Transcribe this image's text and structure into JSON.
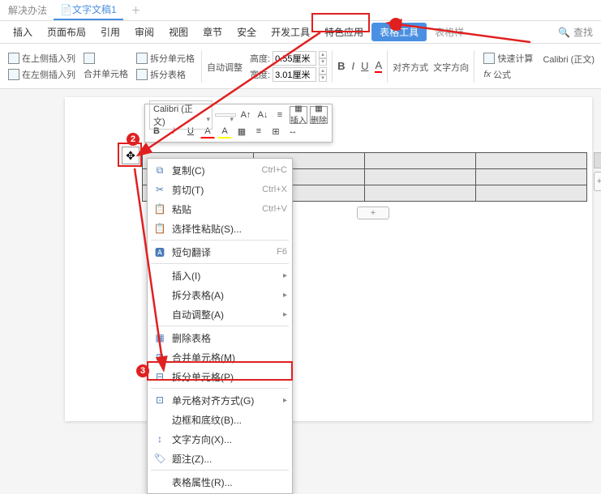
{
  "tabs": {
    "doc1": "解决办法",
    "doc2": "文字文稿1"
  },
  "menu": {
    "insert": "插入",
    "layout": "页面布局",
    "ref": "引用",
    "review": "审阅",
    "view": "视图",
    "chapter": "章节",
    "safe": "安全",
    "dev": "开发工具",
    "special": "特色应用",
    "table_tool": "表格工具",
    "table_style": "表格样",
    "search_icon": "🔍",
    "search": "查找"
  },
  "ribbon": {
    "ins_above": "在上侧插入列",
    "ins_left": "在左侧插入列",
    "merge": "合并单元格",
    "split_cell": "拆分单元格",
    "split_table": "拆分表格",
    "autofit": "自动调整",
    "height": "高度:",
    "height_val": "0.55厘米",
    "width": "宽度:",
    "width_val": "3.01厘米",
    "align": "对齐方式",
    "text_dir": "文字方向",
    "fast_calc": "快速计算",
    "formula": "公式",
    "fx": "fx",
    "calibri": "Calibri (正文)"
  },
  "float": {
    "font": "Calibri (正文)",
    "size": "",
    "B": "B",
    "I": "I",
    "U": "U",
    "insert": "插入",
    "delete": "删除"
  },
  "ctx": {
    "copy": "复制(C)",
    "copy_k": "Ctrl+C",
    "cut": "剪切(T)",
    "cut_k": "Ctrl+X",
    "paste": "粘贴",
    "paste_k": "Ctrl+V",
    "paste_special": "选择性粘贴(S)...",
    "trans": "短句翻译",
    "trans_k": "F6",
    "insert": "插入(I)",
    "split_tbl": "拆分表格(A)",
    "autofit": "自动调整(A)",
    "del_tbl": "删除表格",
    "merge": "合并单元格(M)",
    "split_cell": "拆分单元格(P)...",
    "cell_align": "单元格对齐方式(G)",
    "border": "边框和底纹(B)...",
    "text_dir": "文字方向(X)...",
    "caption": "题注(Z)...",
    "tbl_prop": "表格属性(R)..."
  },
  "handle_glyph": "✥",
  "badges": {
    "one": "1",
    "two": "2",
    "three": "3"
  },
  "plus": "+"
}
